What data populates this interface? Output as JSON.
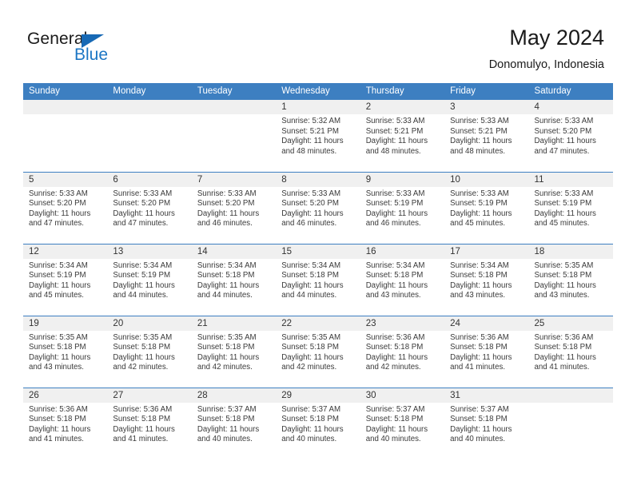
{
  "brand": {
    "name_part1": "General",
    "name_part2": "Blue",
    "triangle_icon": "triangle-icon",
    "accent_color": "#1c76c4"
  },
  "header": {
    "title": "May 2024",
    "subtitle": "Donomulyo, Indonesia"
  },
  "theme": {
    "header_bg": "#3d7fc1",
    "daynum_bg": "#f0f0f0",
    "text": "#3a3a3a"
  },
  "weekdays": [
    "Sunday",
    "Monday",
    "Tuesday",
    "Wednesday",
    "Thursday",
    "Friday",
    "Saturday"
  ],
  "weeks": [
    [
      {
        "day": "",
        "empty": true,
        "sunrise": "",
        "sunset": "",
        "daylight1": "",
        "daylight2": ""
      },
      {
        "day": "",
        "empty": true,
        "sunrise": "",
        "sunset": "",
        "daylight1": "",
        "daylight2": ""
      },
      {
        "day": "",
        "empty": true,
        "sunrise": "",
        "sunset": "",
        "daylight1": "",
        "daylight2": ""
      },
      {
        "day": "1",
        "empty": false,
        "sunrise": "Sunrise: 5:32 AM",
        "sunset": "Sunset: 5:21 PM",
        "daylight1": "Daylight: 11 hours",
        "daylight2": "and 48 minutes."
      },
      {
        "day": "2",
        "empty": false,
        "sunrise": "Sunrise: 5:33 AM",
        "sunset": "Sunset: 5:21 PM",
        "daylight1": "Daylight: 11 hours",
        "daylight2": "and 48 minutes."
      },
      {
        "day": "3",
        "empty": false,
        "sunrise": "Sunrise: 5:33 AM",
        "sunset": "Sunset: 5:21 PM",
        "daylight1": "Daylight: 11 hours",
        "daylight2": "and 48 minutes."
      },
      {
        "day": "4",
        "empty": false,
        "sunrise": "Sunrise: 5:33 AM",
        "sunset": "Sunset: 5:20 PM",
        "daylight1": "Daylight: 11 hours",
        "daylight2": "and 47 minutes."
      }
    ],
    [
      {
        "day": "5",
        "empty": false,
        "sunrise": "Sunrise: 5:33 AM",
        "sunset": "Sunset: 5:20 PM",
        "daylight1": "Daylight: 11 hours",
        "daylight2": "and 47 minutes."
      },
      {
        "day": "6",
        "empty": false,
        "sunrise": "Sunrise: 5:33 AM",
        "sunset": "Sunset: 5:20 PM",
        "daylight1": "Daylight: 11 hours",
        "daylight2": "and 47 minutes."
      },
      {
        "day": "7",
        "empty": false,
        "sunrise": "Sunrise: 5:33 AM",
        "sunset": "Sunset: 5:20 PM",
        "daylight1": "Daylight: 11 hours",
        "daylight2": "and 46 minutes."
      },
      {
        "day": "8",
        "empty": false,
        "sunrise": "Sunrise: 5:33 AM",
        "sunset": "Sunset: 5:20 PM",
        "daylight1": "Daylight: 11 hours",
        "daylight2": "and 46 minutes."
      },
      {
        "day": "9",
        "empty": false,
        "sunrise": "Sunrise: 5:33 AM",
        "sunset": "Sunset: 5:19 PM",
        "daylight1": "Daylight: 11 hours",
        "daylight2": "and 46 minutes."
      },
      {
        "day": "10",
        "empty": false,
        "sunrise": "Sunrise: 5:33 AM",
        "sunset": "Sunset: 5:19 PM",
        "daylight1": "Daylight: 11 hours",
        "daylight2": "and 45 minutes."
      },
      {
        "day": "11",
        "empty": false,
        "sunrise": "Sunrise: 5:33 AM",
        "sunset": "Sunset: 5:19 PM",
        "daylight1": "Daylight: 11 hours",
        "daylight2": "and 45 minutes."
      }
    ],
    [
      {
        "day": "12",
        "empty": false,
        "sunrise": "Sunrise: 5:34 AM",
        "sunset": "Sunset: 5:19 PM",
        "daylight1": "Daylight: 11 hours",
        "daylight2": "and 45 minutes."
      },
      {
        "day": "13",
        "empty": false,
        "sunrise": "Sunrise: 5:34 AM",
        "sunset": "Sunset: 5:19 PM",
        "daylight1": "Daylight: 11 hours",
        "daylight2": "and 44 minutes."
      },
      {
        "day": "14",
        "empty": false,
        "sunrise": "Sunrise: 5:34 AM",
        "sunset": "Sunset: 5:18 PM",
        "daylight1": "Daylight: 11 hours",
        "daylight2": "and 44 minutes."
      },
      {
        "day": "15",
        "empty": false,
        "sunrise": "Sunrise: 5:34 AM",
        "sunset": "Sunset: 5:18 PM",
        "daylight1": "Daylight: 11 hours",
        "daylight2": "and 44 minutes."
      },
      {
        "day": "16",
        "empty": false,
        "sunrise": "Sunrise: 5:34 AM",
        "sunset": "Sunset: 5:18 PM",
        "daylight1": "Daylight: 11 hours",
        "daylight2": "and 43 minutes."
      },
      {
        "day": "17",
        "empty": false,
        "sunrise": "Sunrise: 5:34 AM",
        "sunset": "Sunset: 5:18 PM",
        "daylight1": "Daylight: 11 hours",
        "daylight2": "and 43 minutes."
      },
      {
        "day": "18",
        "empty": false,
        "sunrise": "Sunrise: 5:35 AM",
        "sunset": "Sunset: 5:18 PM",
        "daylight1": "Daylight: 11 hours",
        "daylight2": "and 43 minutes."
      }
    ],
    [
      {
        "day": "19",
        "empty": false,
        "sunrise": "Sunrise: 5:35 AM",
        "sunset": "Sunset: 5:18 PM",
        "daylight1": "Daylight: 11 hours",
        "daylight2": "and 43 minutes."
      },
      {
        "day": "20",
        "empty": false,
        "sunrise": "Sunrise: 5:35 AM",
        "sunset": "Sunset: 5:18 PM",
        "daylight1": "Daylight: 11 hours",
        "daylight2": "and 42 minutes."
      },
      {
        "day": "21",
        "empty": false,
        "sunrise": "Sunrise: 5:35 AM",
        "sunset": "Sunset: 5:18 PM",
        "daylight1": "Daylight: 11 hours",
        "daylight2": "and 42 minutes."
      },
      {
        "day": "22",
        "empty": false,
        "sunrise": "Sunrise: 5:35 AM",
        "sunset": "Sunset: 5:18 PM",
        "daylight1": "Daylight: 11 hours",
        "daylight2": "and 42 minutes."
      },
      {
        "day": "23",
        "empty": false,
        "sunrise": "Sunrise: 5:36 AM",
        "sunset": "Sunset: 5:18 PM",
        "daylight1": "Daylight: 11 hours",
        "daylight2": "and 42 minutes."
      },
      {
        "day": "24",
        "empty": false,
        "sunrise": "Sunrise: 5:36 AM",
        "sunset": "Sunset: 5:18 PM",
        "daylight1": "Daylight: 11 hours",
        "daylight2": "and 41 minutes."
      },
      {
        "day": "25",
        "empty": false,
        "sunrise": "Sunrise: 5:36 AM",
        "sunset": "Sunset: 5:18 PM",
        "daylight1": "Daylight: 11 hours",
        "daylight2": "and 41 minutes."
      }
    ],
    [
      {
        "day": "26",
        "empty": false,
        "sunrise": "Sunrise: 5:36 AM",
        "sunset": "Sunset: 5:18 PM",
        "daylight1": "Daylight: 11 hours",
        "daylight2": "and 41 minutes."
      },
      {
        "day": "27",
        "empty": false,
        "sunrise": "Sunrise: 5:36 AM",
        "sunset": "Sunset: 5:18 PM",
        "daylight1": "Daylight: 11 hours",
        "daylight2": "and 41 minutes."
      },
      {
        "day": "28",
        "empty": false,
        "sunrise": "Sunrise: 5:37 AM",
        "sunset": "Sunset: 5:18 PM",
        "daylight1": "Daylight: 11 hours",
        "daylight2": "and 40 minutes."
      },
      {
        "day": "29",
        "empty": false,
        "sunrise": "Sunrise: 5:37 AM",
        "sunset": "Sunset: 5:18 PM",
        "daylight1": "Daylight: 11 hours",
        "daylight2": "and 40 minutes."
      },
      {
        "day": "30",
        "empty": false,
        "sunrise": "Sunrise: 5:37 AM",
        "sunset": "Sunset: 5:18 PM",
        "daylight1": "Daylight: 11 hours",
        "daylight2": "and 40 minutes."
      },
      {
        "day": "31",
        "empty": false,
        "sunrise": "Sunrise: 5:37 AM",
        "sunset": "Sunset: 5:18 PM",
        "daylight1": "Daylight: 11 hours",
        "daylight2": "and 40 minutes."
      },
      {
        "day": "",
        "empty": true,
        "sunrise": "",
        "sunset": "",
        "daylight1": "",
        "daylight2": ""
      }
    ]
  ]
}
